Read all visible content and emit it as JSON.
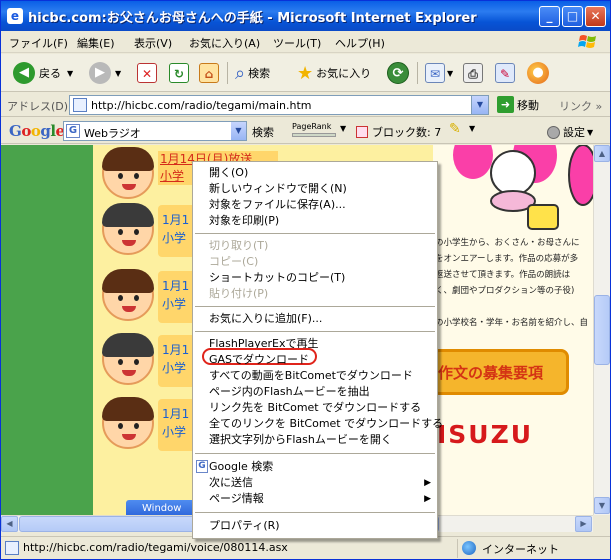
{
  "window": {
    "title": "hicbc.com:お父さんお母さんへの手紙 - Microsoft Internet Explorer",
    "icon_label": "e",
    "buttons": {
      "minimize": "_",
      "maximize": "□",
      "close": "✕"
    }
  },
  "menubar": {
    "items": [
      "ファイル(F)",
      "編集(E)",
      "表示(V)",
      "お気に入り(A)",
      "ツール(T)",
      "ヘルプ(H)"
    ]
  },
  "toolbar": {
    "back_label": "戻る",
    "search_label": "検索",
    "favorites_label": "お気に入り"
  },
  "addressbar": {
    "label": "アドレス(D)",
    "url": "http://hicbc.com/radio/tegami/main.htm",
    "go_label": "移動",
    "links_label": "リンク »"
  },
  "googlebar": {
    "logo": "Google",
    "search_value": "Webラジオ",
    "search_button": "検索",
    "pagerank_label": "PageRank",
    "popup_blocked": "ブロック数: 7",
    "settings_label": "設定"
  },
  "page": {
    "entries": [
      {
        "line1": "1月14日(月)放送",
        "line2": "小学"
      },
      {
        "line1": "1月1",
        "line2": "小学"
      },
      {
        "line1": "1月1",
        "line2": "小学"
      },
      {
        "line1": "1月1",
        "line2": "小学"
      },
      {
        "line1": "1月1",
        "line2": "小学"
      }
    ],
    "side_text": [
      "の小学生から、おくさん・お母さんに",
      "をオンエアーします。作品の応募が多",
      "返送させて頂きます。作品の朗読は",
      "く、劇団やプロダクション等の子役)",
      "。",
      "の小学校名・学年・お名前を紹介し、自"
    ],
    "banner": "作文の募集要項",
    "sponsor": "ISUZU",
    "taskbar_button": "Window"
  },
  "context_menu": {
    "items": [
      {
        "label": "開く(O)",
        "enabled": true
      },
      {
        "label": "新しいウィンドウで開く(N)",
        "enabled": true
      },
      {
        "label": "対象をファイルに保存(A)...",
        "enabled": true
      },
      {
        "label": "対象を印刷(P)",
        "enabled": true
      },
      {
        "label": "切り取り(T)",
        "enabled": false
      },
      {
        "label": "コピー(C)",
        "enabled": false
      },
      {
        "label": "ショートカットのコピー(T)",
        "enabled": true
      },
      {
        "label": "貼り付け(P)",
        "enabled": false
      },
      {
        "label": "お気に入りに追加(F)...",
        "enabled": true
      },
      {
        "label": "FlashPlayerExで再生",
        "enabled": true
      },
      {
        "label": "GASでダウンロード",
        "enabled": true
      },
      {
        "label": "すべての動画をBitCometでダウンロード",
        "enabled": true
      },
      {
        "label": "ページ内のFlashムービーを抽出",
        "enabled": true
      },
      {
        "label": "リンク先を BitComet でダウンロードする",
        "enabled": true
      },
      {
        "label": "全てのリンクを BitComet でダウンロードする",
        "enabled": true
      },
      {
        "label": "選択文字列からFlashムービーを開く",
        "enabled": true
      },
      {
        "label": "Google 検索",
        "enabled": true
      },
      {
        "label": "次に送信",
        "enabled": true
      },
      {
        "label": "ページ情報",
        "enabled": true
      },
      {
        "label": "プロパティ(R)",
        "enabled": true
      }
    ]
  },
  "statusbar": {
    "text": "http://hicbc.com/radio/tegami/voice/080114.asx",
    "zone": "インターネット"
  },
  "colors": {
    "title_blue": "#0a5fe6",
    "page_green": "#58b05a",
    "highlight_red": "#e0241b",
    "sponsor_red": "#d6191b"
  }
}
